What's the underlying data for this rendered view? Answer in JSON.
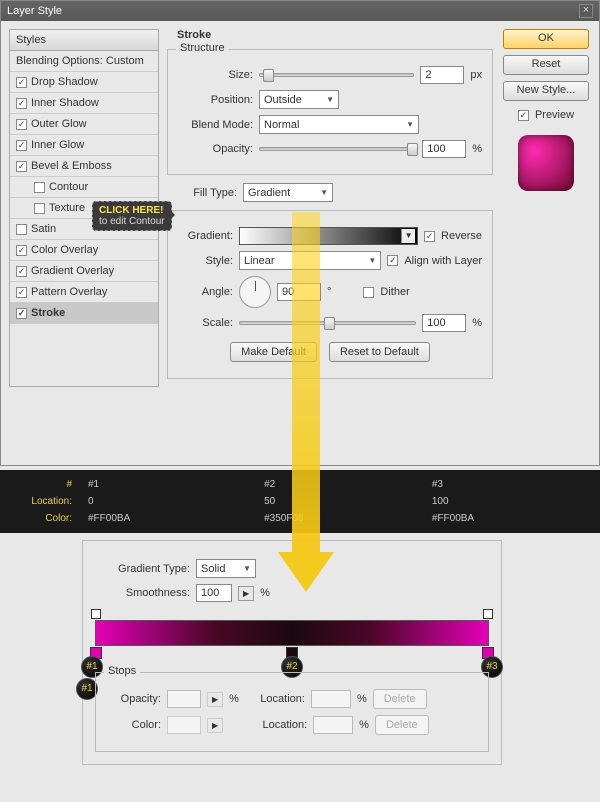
{
  "title": "Layer Style",
  "styles_header": "Styles",
  "blending": "Blending Options: Custom",
  "effects": [
    {
      "label": "Drop Shadow",
      "checked": true
    },
    {
      "label": "Inner Shadow",
      "checked": true
    },
    {
      "label": "Outer Glow",
      "checked": true
    },
    {
      "label": "Inner Glow",
      "checked": true
    },
    {
      "label": "Bevel & Emboss",
      "checked": true
    },
    {
      "label": "Contour",
      "checked": false,
      "indent": true
    },
    {
      "label": "Texture",
      "checked": false,
      "indent": true
    },
    {
      "label": "Satin",
      "checked": false
    },
    {
      "label": "Color Overlay",
      "checked": true
    },
    {
      "label": "Gradient Overlay",
      "checked": true
    },
    {
      "label": "Pattern Overlay",
      "checked": true
    },
    {
      "label": "Stroke",
      "checked": true,
      "selected": true
    }
  ],
  "stroke": {
    "title": "Stroke",
    "structure": "Structure",
    "size_label": "Size:",
    "size": "2",
    "px": "px",
    "position_label": "Position:",
    "position": "Outside",
    "blend_label": "Blend Mode:",
    "blend": "Normal",
    "opacity_label": "Opacity:",
    "opacity": "100",
    "pct": "%",
    "filltype_label": "Fill Type:",
    "filltype": "Gradient",
    "gradient_label": "Gradient:",
    "reverse": "Reverse",
    "style_label": "Style:",
    "style": "Linear",
    "align": "Align with Layer",
    "angle_label": "Angle:",
    "angle": "90",
    "deg": "°",
    "dither": "Dither",
    "scale_label": "Scale:",
    "scale": "100",
    "make_default": "Make Default",
    "reset_default": "Reset to Default"
  },
  "buttons": {
    "ok": "OK",
    "reset": "Reset",
    "new_style": "New Style...",
    "preview": "Preview"
  },
  "callout": {
    "l1": "CLICK HERE!",
    "l2": "to edit Contour"
  },
  "info": {
    "cols": [
      "#",
      "#1",
      "#2",
      "#3"
    ],
    "loc_label": "Location:",
    "loc": [
      "0",
      "50",
      "100"
    ],
    "color_label": "Color:",
    "color": [
      "#FF00BA",
      "#350F08",
      "#FF00BA"
    ]
  },
  "editor": {
    "gtype_label": "Gradient Type:",
    "gtype": "Solid",
    "smooth_label": "Smoothness:",
    "smooth": "100",
    "pct": "%",
    "stops_title": "Stops",
    "opacity_label": "Opacity:",
    "location_label": "Location:",
    "color_label": "Color:",
    "delete": "Delete",
    "b1": "#1",
    "b2": "#2",
    "b3": "#3"
  }
}
